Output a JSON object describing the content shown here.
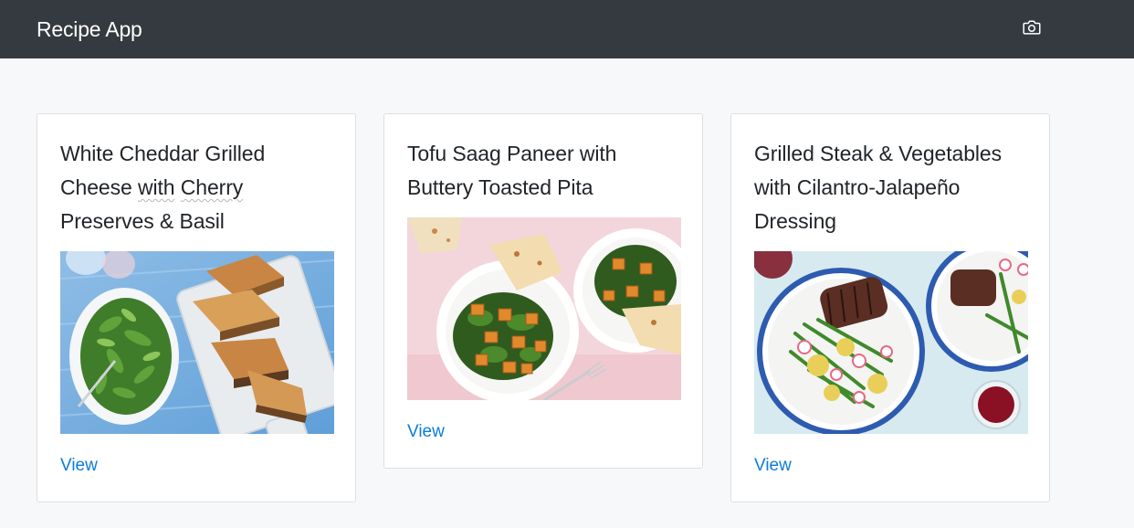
{
  "app": {
    "title": "Recipe App",
    "camera_icon": "camera-icon"
  },
  "colors": {
    "navbar": "#343a40",
    "background": "#f7f8fa",
    "link": "#0a7cdc"
  },
  "recipes": [
    {
      "title": "White Cheddar Grilled Cheese with Cherry Preserves & Basil",
      "title_parts": [
        "White Cheddar Grilled Cheese ",
        "with",
        " ",
        "Cherry",
        " Preserves & Basil"
      ],
      "image": "grilled-cheese-and-salad-photo",
      "link_label": "View"
    },
    {
      "title": "Tofu Saag Paneer with Buttery Toasted Pita",
      "image": "tofu-saag-paneer-photo",
      "link_label": "View"
    },
    {
      "title": "Grilled Steak & Vegetables with Cilantro-Jalapeño Dressing",
      "image": "steak-and-vegetables-photo",
      "link_label": "View"
    }
  ]
}
